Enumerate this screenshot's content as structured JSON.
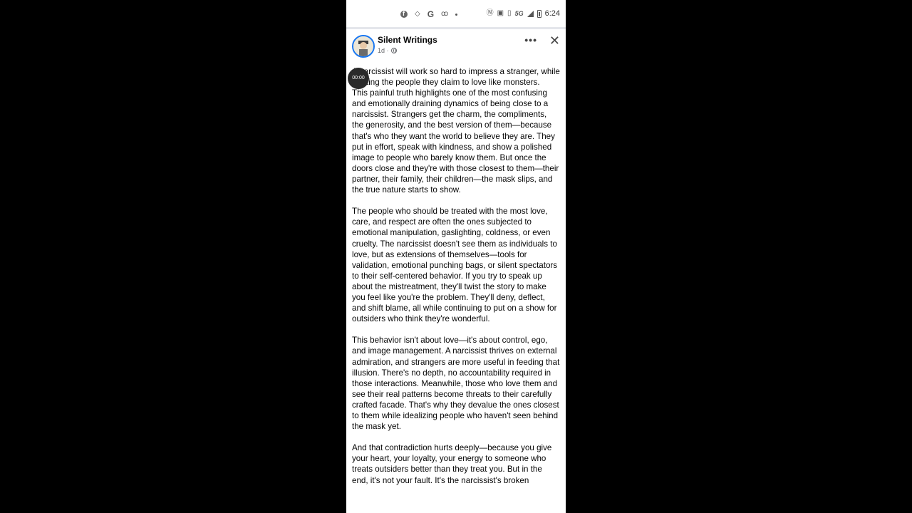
{
  "status_bar": {
    "icons_left": [
      "facebook-icon",
      "diamond-icon",
      "google-icon",
      "voicemail-icon",
      "dot-icon"
    ],
    "icons_right": [
      "nfc-icon",
      "cast-icon",
      "vibrate-icon",
      "signal-5g-icon",
      "battery-icon"
    ],
    "network": "5G",
    "time": "6:24"
  },
  "post": {
    "author": "Silent Writings",
    "age": "1d ·",
    "timer": "00:00",
    "paragraphs": [
      "A narcissist will work so hard to impress a stranger, while treating the people they claim to love like monsters.\nThis painful truth highlights one of the most confusing and emotionally draining dynamics of being close to a narcissist. Strangers get the charm, the compliments, the generosity, and the best version of them—because that's who they want the world to believe they are. They put in effort, speak with kindness, and show a polished image to people who barely know them. But once the doors close and they're with those closest to them—their partner, their family, their children—the mask slips, and the true nature starts to show.",
      "The people who should be treated with the most love, care, and respect are often the ones subjected to emotional manipulation, gaslighting, coldness, or even cruelty. The narcissist doesn't see them as individuals to love, but as extensions of themselves—tools for validation, emotional punching bags, or silent spectators to their self-centered behavior. If you try to speak up about the mistreatment, they'll twist the story to make you feel like you're the problem. They'll deny, deflect, and shift blame, all while continuing to put on a show for outsiders who think they're wonderful.",
      "This behavior isn't about love—it's about control, ego, and image management. A narcissist thrives on external admiration, and strangers are more useful in feeding that illusion. There's no depth, no accountability required in those interactions. Meanwhile, those who love them and see their real patterns become threats to their carefully crafted facade. That's why they devalue the ones closest to them while idealizing people who haven't seen behind the mask yet.",
      "And that contradiction hurts deeply—because you give your heart, your loyalty, your energy to someone who treats outsiders better than they treat you. But in the end, it's not your fault. It's the narcissist's broken"
    ]
  },
  "colors": {
    "avatar_ring": "#1877f2",
    "text": "#050505",
    "meta": "#65676b"
  }
}
